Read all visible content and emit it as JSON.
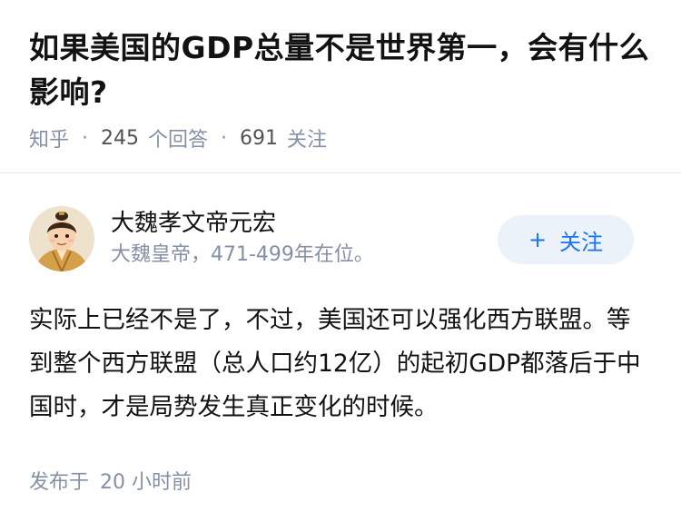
{
  "question": {
    "title": "如果美国的GDP总量不是世界第一，会有什么影响?",
    "source": "知乎",
    "answer_count": "245",
    "answer_label": "个回答",
    "follower_count": "691",
    "follower_label": "关注"
  },
  "answer": {
    "author_name": "大魏孝文帝元宏",
    "author_bio": "大魏皇帝，471-499年在位。",
    "follow_label": "关注",
    "follow_icon": "plus-icon",
    "content": "实际上已经不是了，不过，美国还可以强化西方联盟。等到整个西方联盟（总人口约12亿）的起初GDP都落后于中国时，才是局势发生真正变化的时候。",
    "posted_label": "发布于",
    "posted_time": "20 小时前"
  },
  "colors": {
    "accent": "#1772f6",
    "follow_bg": "#ebf2fa",
    "meta_gray": "#8590a6"
  }
}
